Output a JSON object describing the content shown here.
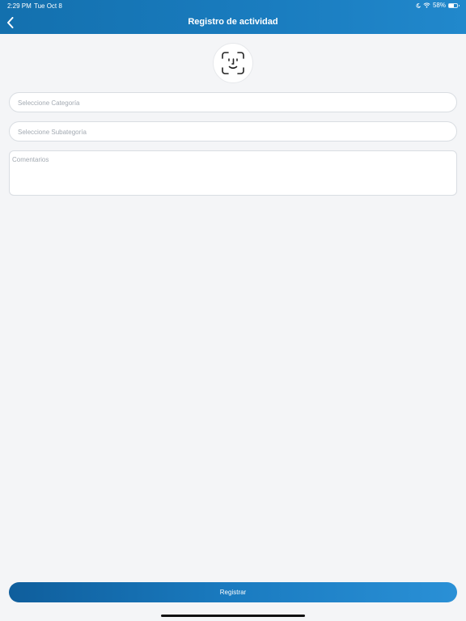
{
  "status_bar": {
    "time": "2:29 PM",
    "date": "Tue Oct 8",
    "battery_percent": "58%",
    "battery_level": 0.58,
    "icons": [
      "moon-icon",
      "wifi-icon",
      "battery-icon"
    ]
  },
  "nav": {
    "title": "Registro de actividad",
    "back_icon": "chevron-left-icon"
  },
  "avatar_icon": "face-id-icon",
  "form": {
    "category_placeholder": "Seleccione Categoría",
    "subcategory_placeholder": "Seleccione Subategoría",
    "comments_placeholder": "Comentarios"
  },
  "submit_label": "Registrar",
  "colors": {
    "header_start": "#1370ae",
    "header_end": "#2188cc",
    "background": "#f4f5f7",
    "placeholder": "#a3aab2"
  }
}
